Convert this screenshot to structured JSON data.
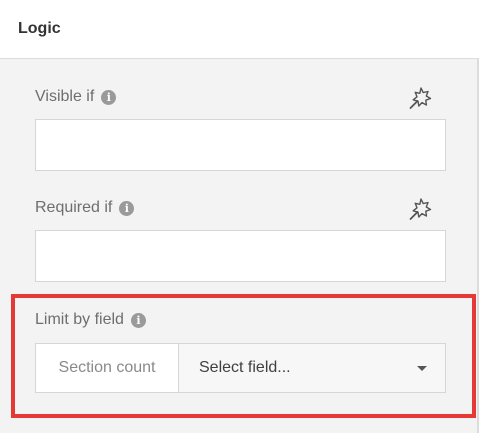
{
  "panel": {
    "title": "Logic"
  },
  "visible_if": {
    "label": "Visible if",
    "info_icon": "info-icon",
    "action_icon": "magic-wand-icon",
    "value": ""
  },
  "required_if": {
    "label": "Required if",
    "info_icon": "info-icon",
    "action_icon": "magic-wand-icon",
    "value": ""
  },
  "limit_by_field": {
    "label": "Limit by field",
    "info_icon": "info-icon",
    "prefix": "Section count",
    "select_value": "Select field..."
  },
  "colors": {
    "highlight": "#e53935",
    "background": "#f3f3f3"
  }
}
